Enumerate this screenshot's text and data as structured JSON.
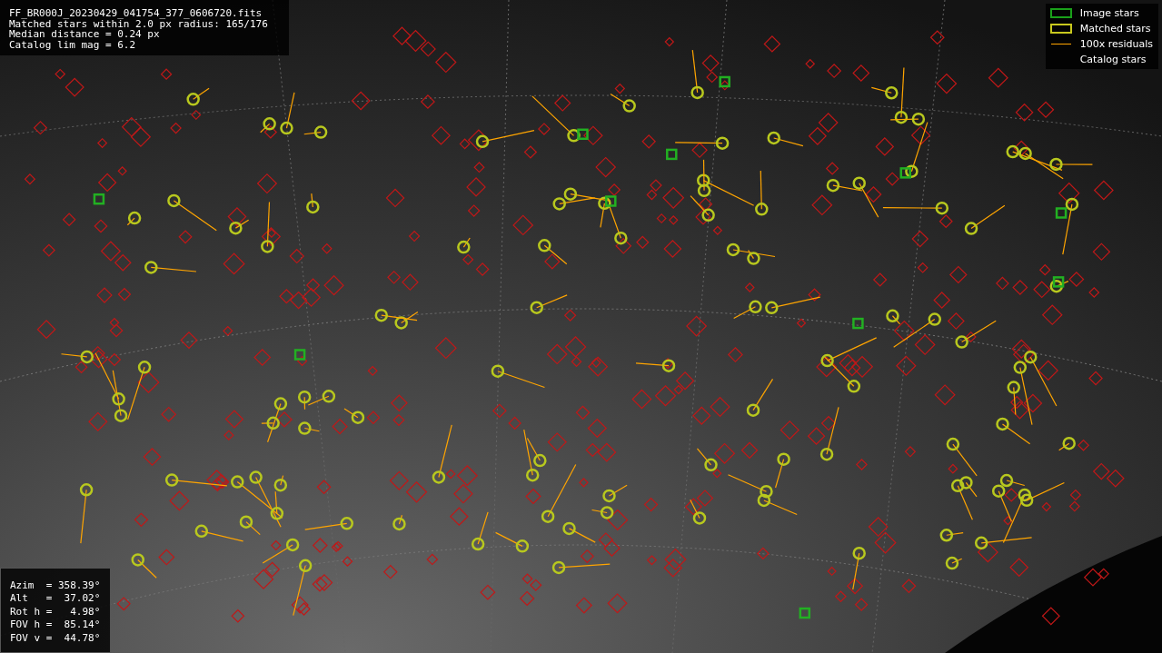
{
  "file_info": [
    "FF_BR000J_20230429_041754_377_0606720.fits",
    "Matched stars within 2.0 px radius: 165/176",
    "Median distance = 0.24 px",
    "Catalog lim mag = 6.2"
  ],
  "legend": [
    {
      "label": "Image stars",
      "kind": "box",
      "color": "#1aa01a"
    },
    {
      "label": "Matched stars",
      "kind": "box",
      "color": "#c8c81e"
    },
    {
      "label": "100x residuals",
      "kind": "line",
      "color": "#ffa500"
    },
    {
      "label": "Catalog stars",
      "kind": "none"
    }
  ],
  "pointing": [
    "Azim  = 358.39°",
    "Alt   =  37.02°",
    "Rot h =   4.98°",
    "FOV h =  85.14°",
    "FOV v =  44.78°"
  ]
}
